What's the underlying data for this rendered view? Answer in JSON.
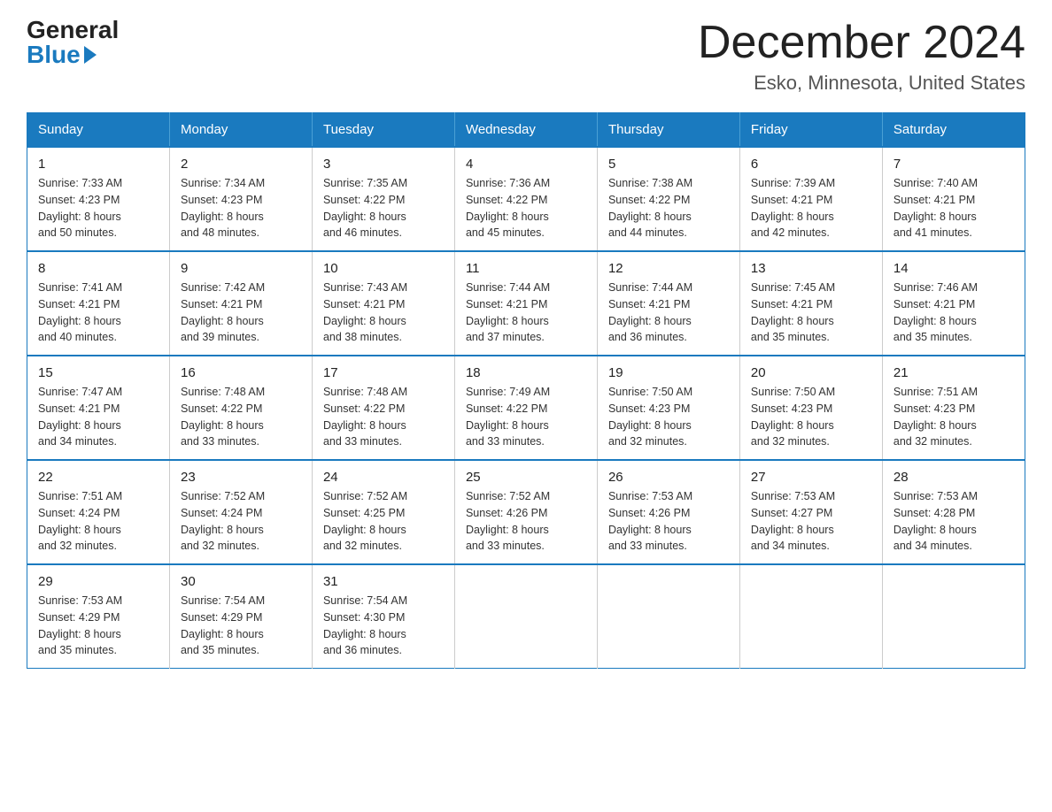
{
  "header": {
    "logo_general": "General",
    "logo_blue": "Blue",
    "month_title": "December 2024",
    "location": "Esko, Minnesota, United States"
  },
  "weekdays": [
    "Sunday",
    "Monday",
    "Tuesday",
    "Wednesday",
    "Thursday",
    "Friday",
    "Saturday"
  ],
  "weeks": [
    [
      {
        "day": "1",
        "sunrise": "7:33 AM",
        "sunset": "4:23 PM",
        "daylight": "8 hours and 50 minutes."
      },
      {
        "day": "2",
        "sunrise": "7:34 AM",
        "sunset": "4:23 PM",
        "daylight": "8 hours and 48 minutes."
      },
      {
        "day": "3",
        "sunrise": "7:35 AM",
        "sunset": "4:22 PM",
        "daylight": "8 hours and 46 minutes."
      },
      {
        "day": "4",
        "sunrise": "7:36 AM",
        "sunset": "4:22 PM",
        "daylight": "8 hours and 45 minutes."
      },
      {
        "day": "5",
        "sunrise": "7:38 AM",
        "sunset": "4:22 PM",
        "daylight": "8 hours and 44 minutes."
      },
      {
        "day": "6",
        "sunrise": "7:39 AM",
        "sunset": "4:21 PM",
        "daylight": "8 hours and 42 minutes."
      },
      {
        "day": "7",
        "sunrise": "7:40 AM",
        "sunset": "4:21 PM",
        "daylight": "8 hours and 41 minutes."
      }
    ],
    [
      {
        "day": "8",
        "sunrise": "7:41 AM",
        "sunset": "4:21 PM",
        "daylight": "8 hours and 40 minutes."
      },
      {
        "day": "9",
        "sunrise": "7:42 AM",
        "sunset": "4:21 PM",
        "daylight": "8 hours and 39 minutes."
      },
      {
        "day": "10",
        "sunrise": "7:43 AM",
        "sunset": "4:21 PM",
        "daylight": "8 hours and 38 minutes."
      },
      {
        "day": "11",
        "sunrise": "7:44 AM",
        "sunset": "4:21 PM",
        "daylight": "8 hours and 37 minutes."
      },
      {
        "day": "12",
        "sunrise": "7:44 AM",
        "sunset": "4:21 PM",
        "daylight": "8 hours and 36 minutes."
      },
      {
        "day": "13",
        "sunrise": "7:45 AM",
        "sunset": "4:21 PM",
        "daylight": "8 hours and 35 minutes."
      },
      {
        "day": "14",
        "sunrise": "7:46 AM",
        "sunset": "4:21 PM",
        "daylight": "8 hours and 35 minutes."
      }
    ],
    [
      {
        "day": "15",
        "sunrise": "7:47 AM",
        "sunset": "4:21 PM",
        "daylight": "8 hours and 34 minutes."
      },
      {
        "day": "16",
        "sunrise": "7:48 AM",
        "sunset": "4:22 PM",
        "daylight": "8 hours and 33 minutes."
      },
      {
        "day": "17",
        "sunrise": "7:48 AM",
        "sunset": "4:22 PM",
        "daylight": "8 hours and 33 minutes."
      },
      {
        "day": "18",
        "sunrise": "7:49 AM",
        "sunset": "4:22 PM",
        "daylight": "8 hours and 33 minutes."
      },
      {
        "day": "19",
        "sunrise": "7:50 AM",
        "sunset": "4:23 PM",
        "daylight": "8 hours and 32 minutes."
      },
      {
        "day": "20",
        "sunrise": "7:50 AM",
        "sunset": "4:23 PM",
        "daylight": "8 hours and 32 minutes."
      },
      {
        "day": "21",
        "sunrise": "7:51 AM",
        "sunset": "4:23 PM",
        "daylight": "8 hours and 32 minutes."
      }
    ],
    [
      {
        "day": "22",
        "sunrise": "7:51 AM",
        "sunset": "4:24 PM",
        "daylight": "8 hours and 32 minutes."
      },
      {
        "day": "23",
        "sunrise": "7:52 AM",
        "sunset": "4:24 PM",
        "daylight": "8 hours and 32 minutes."
      },
      {
        "day": "24",
        "sunrise": "7:52 AM",
        "sunset": "4:25 PM",
        "daylight": "8 hours and 32 minutes."
      },
      {
        "day": "25",
        "sunrise": "7:52 AM",
        "sunset": "4:26 PM",
        "daylight": "8 hours and 33 minutes."
      },
      {
        "day": "26",
        "sunrise": "7:53 AM",
        "sunset": "4:26 PM",
        "daylight": "8 hours and 33 minutes."
      },
      {
        "day": "27",
        "sunrise": "7:53 AM",
        "sunset": "4:27 PM",
        "daylight": "8 hours and 34 minutes."
      },
      {
        "day": "28",
        "sunrise": "7:53 AM",
        "sunset": "4:28 PM",
        "daylight": "8 hours and 34 minutes."
      }
    ],
    [
      {
        "day": "29",
        "sunrise": "7:53 AM",
        "sunset": "4:29 PM",
        "daylight": "8 hours and 35 minutes."
      },
      {
        "day": "30",
        "sunrise": "7:54 AM",
        "sunset": "4:29 PM",
        "daylight": "8 hours and 35 minutes."
      },
      {
        "day": "31",
        "sunrise": "7:54 AM",
        "sunset": "4:30 PM",
        "daylight": "8 hours and 36 minutes."
      },
      null,
      null,
      null,
      null
    ]
  ],
  "labels": {
    "sunrise": "Sunrise:",
    "sunset": "Sunset:",
    "daylight": "Daylight:"
  }
}
